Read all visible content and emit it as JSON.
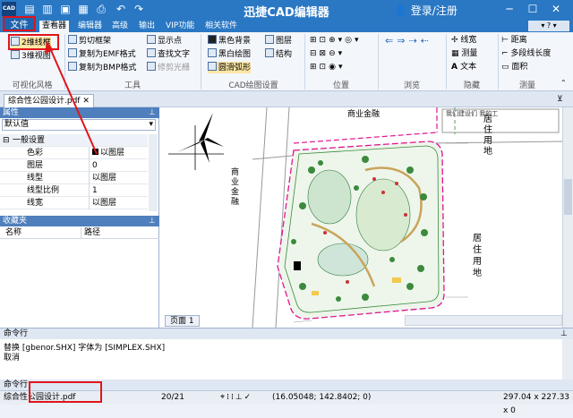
{
  "app": {
    "title": "迅捷CAD编辑器",
    "login": "登录/注册",
    "logo": "CAD",
    "min": "─",
    "max": "☐",
    "close": "✕"
  },
  "qa_icons": [
    "folder-icon",
    "save-icon",
    "pdf-icon",
    "print-icon",
    "undo-icon",
    "redo-icon"
  ],
  "tabs": {
    "file": "文件",
    "items": [
      "查看器",
      "编辑器",
      "高级",
      "输出",
      "VIP功能",
      "相关软件"
    ]
  },
  "ribbon": {
    "visual": {
      "btn1": "2维线框",
      "btn2": "3维视图",
      "label": "可视化风格"
    },
    "tools": {
      "b1": "剪切框架",
      "b2": "复制为EMF格式",
      "b3": "复制为BMP格式",
      "b4": "显示点",
      "b5": "查找文字",
      "b6": "修剪光栅",
      "label": "工具"
    },
    "cad": {
      "b1": "黑色背景",
      "b2": "黑白绘图",
      "b3": "圆滑弧形",
      "b4": "图层",
      "b5": "结构",
      "label": "CAD绘图设置"
    },
    "position": {
      "label": "位置"
    },
    "browse": {
      "label": "浏览"
    },
    "hide": {
      "b1": "线宽",
      "b2": "测量",
      "b3": "文本",
      "label": "隐藏"
    },
    "measure": {
      "b1": "距离",
      "b2": "多段线长度",
      "b3": "面积",
      "label": "测量"
    }
  },
  "document": {
    "tab": "综合性公园设计.pdf"
  },
  "properties": {
    "header": "属性",
    "default": "默认值",
    "group": "一般设置",
    "rows": [
      {
        "k": "色彩",
        "v": "以图层"
      },
      {
        "k": "图层",
        "v": "0"
      },
      {
        "k": "线型",
        "v": "以图层"
      },
      {
        "k": "线型比例",
        "v": "1"
      },
      {
        "k": "线宽",
        "v": "以图层"
      }
    ]
  },
  "favorites": {
    "header": "收藏夹",
    "col_name": "名称",
    "col_path": "路径"
  },
  "canvas": {
    "labels": {
      "commercial_top": "商业金融",
      "commercial_left": "商",
      "commercial_left2": "业",
      "commercial_left3": "金",
      "commercial_left4": "融",
      "residential": "居",
      "residential2": "住",
      "residential3": "用",
      "residential4": "地",
      "res_top": "居",
      "res_top2": "住",
      "res_top3": "用",
      "res_top4": "地",
      "note": "我们建设们 我的工"
    },
    "page_tab": "页面 1"
  },
  "command": {
    "header": "命令行",
    "line1": "替换 [gbenor.SHX] 字体为 [SIMPLEX.SHX]",
    "line2": "取消",
    "prompt": "命令行"
  },
  "status": {
    "file": "综合性公园设计.pdf",
    "page": "20/21",
    "coords": "(16.05048; 142.8402; 0)",
    "size": "297.04 x 227.33 x 0"
  }
}
